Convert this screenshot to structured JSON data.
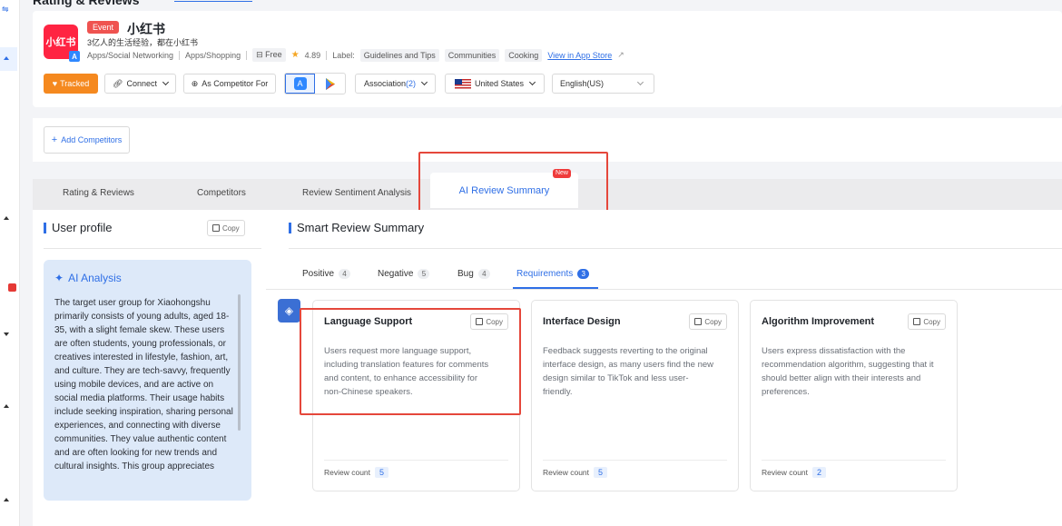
{
  "section": {
    "title": "Rating & Reviews"
  },
  "app": {
    "icon_text": "小红书",
    "event_badge": "Event",
    "name": "小红书",
    "subtitle": "3亿人的生活经验，都在小红书",
    "category_1": "Apps/Social Networking",
    "category_2": "Apps/Shopping",
    "price": "Free",
    "rating": "4.89",
    "label_prefix": "Label:",
    "labels": [
      "Guidelines and Tips",
      "Communities",
      "Cooking"
    ],
    "store_link": "View in App Store"
  },
  "toolbar": {
    "tracked": "Tracked",
    "connect": "Connect",
    "as_competitor": "As Competitor For",
    "association_label": "Association",
    "association_count": "(2)",
    "country": "United States",
    "language": "English(US)"
  },
  "competitors": {
    "add_label": "Add Competitors"
  },
  "tabs": {
    "items": [
      "Rating & Reviews",
      "Competitors",
      "Review Sentiment Analysis"
    ],
    "active": "AI Review Summary",
    "new_badge": "New"
  },
  "user_profile": {
    "title": "User profile",
    "copy": "Copy",
    "ai_title": "AI Analysis",
    "analysis": "The target user group for Xiaohongshu primarily consists of young adults, aged 18-35, with a slight female skew. These users are often students, young professionals, or creatives interested in lifestyle, fashion, art, and culture. They are tech-savvy, frequently using mobile devices, and are active on social media platforms. Their usage habits include seeking inspiration, sharing personal experiences, and connecting with diverse communities. They value authentic content and are often looking for new trends and cultural insights. This group appreciates"
  },
  "summary": {
    "title": "Smart Review Summary",
    "subtabs": [
      {
        "label": "Positive",
        "count": "4"
      },
      {
        "label": "Negative",
        "count": "5"
      },
      {
        "label": "Bug",
        "count": "4"
      },
      {
        "label": "Requirements",
        "count": "3"
      }
    ],
    "review_count_label": "Review count",
    "copy": "Copy",
    "cards": [
      {
        "title": "Language Support",
        "desc": "Users request more language support, including translation features for comments and content, to enhance accessibility for non-Chinese speakers.",
        "count": "5"
      },
      {
        "title": "Interface Design",
        "desc": "Feedback suggests reverting to the original interface design, as many users find the new design similar to TikTok and less user-friendly.",
        "count": "5"
      },
      {
        "title": "Algorithm Improvement",
        "desc": "Users express dissatisfaction with the recommendation algorithm, suggesting that it should better align with their interests and preferences.",
        "count": "2"
      }
    ]
  },
  "colors": {
    "accent": "#2f6fe6",
    "tracked": "#f5891f",
    "highlight": "#e5473b",
    "brand": "#ff2442"
  }
}
